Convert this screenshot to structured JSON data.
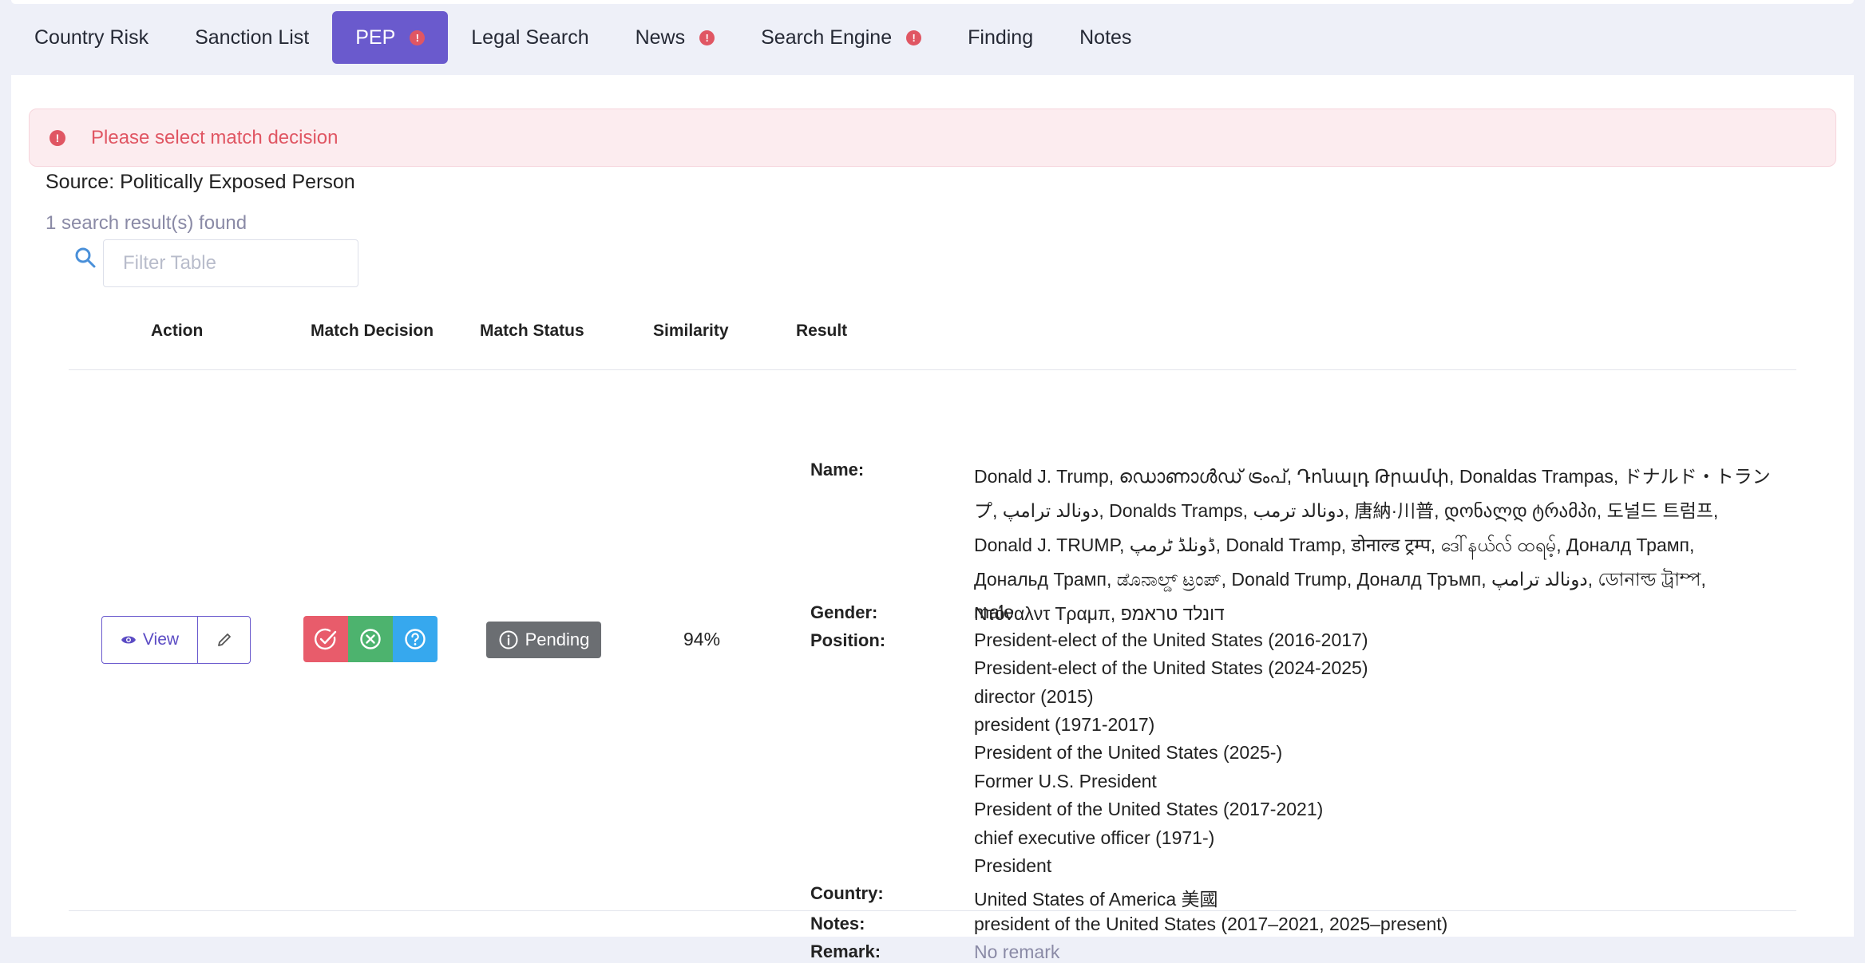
{
  "tabs": [
    {
      "label": "Country Risk",
      "alert": false,
      "active": false
    },
    {
      "label": "Sanction List",
      "alert": false,
      "active": false
    },
    {
      "label": "PEP",
      "alert": true,
      "active": true
    },
    {
      "label": "Legal Search",
      "alert": false,
      "active": false
    },
    {
      "label": "News",
      "alert": true,
      "active": false
    },
    {
      "label": "Search Engine",
      "alert": true,
      "active": false
    },
    {
      "label": "Finding",
      "alert": false,
      "active": false
    },
    {
      "label": "Notes",
      "alert": false,
      "active": false
    }
  ],
  "alert": {
    "icon": "!",
    "message": "Please select match decision"
  },
  "source_text": "Source: Politically Exposed Person",
  "results_found": "1 search result(s) found",
  "filter": {
    "placeholder": "Filter Table",
    "value": ""
  },
  "table": {
    "headers": {
      "action": "Action",
      "match_decision": "Match Decision",
      "match_status": "Match Status",
      "similarity": "Similarity",
      "result": "Result"
    },
    "row": {
      "view_label": "View",
      "status": "Pending",
      "similarity": "94%",
      "labels": {
        "name": "Name:",
        "gender": "Gender:",
        "position": "Position:",
        "country": "Country:",
        "notes": "Notes:",
        "remark": "Remark:"
      },
      "name": "Donald J. Trump, ഡൊണാൾഡ് ട്രംപ്, Դոնալդ Թրամփ, Donaldas Trampas, ドナルド・トランプ, دونالد ترامپ, Donalds Tramps, دونالد ترمب, 唐納·川普, დონალდ ტრამპი, 도널드 트럼프, Donald J. TRUMP, ڈونلڈ ٹرمپ, Donald Tramp, डोनाल्ड ट्रम्प, ဒေါ်နယ်လ် ထရမ့်, Доналд Трамп, Дональд Трамп, ಡೊನಾಲ್ಡ್ ಟ್ರಂಪ್, Donald Trump, Доналд Тръмп, دونالد ترامپ, ডোনাল্ড ট্রাম্প, Ντόναλντ Τραμπ, דונלד טראמפ",
      "gender": "male",
      "positions": [
        "President-elect of the United States (2016-2017)",
        "President-elect of the United States (2024-2025)",
        "director (2015)",
        "president (1971-2017)",
        "President of the United States (2025-)",
        "Former U.S. President",
        "President of the United States (2017-2021)",
        "chief executive officer (1971-)",
        "President"
      ],
      "country": "United States of America 美國",
      "notes": "president of the United States (2017–2021, 2025–present)",
      "remark": "No remark"
    }
  },
  "colors": {
    "accent": "#6a5acd",
    "alert": "#e05663",
    "match": "#e85c6b",
    "no_match": "#4db36e",
    "unsure": "#36a8ee",
    "pending": "#6b6e72"
  }
}
